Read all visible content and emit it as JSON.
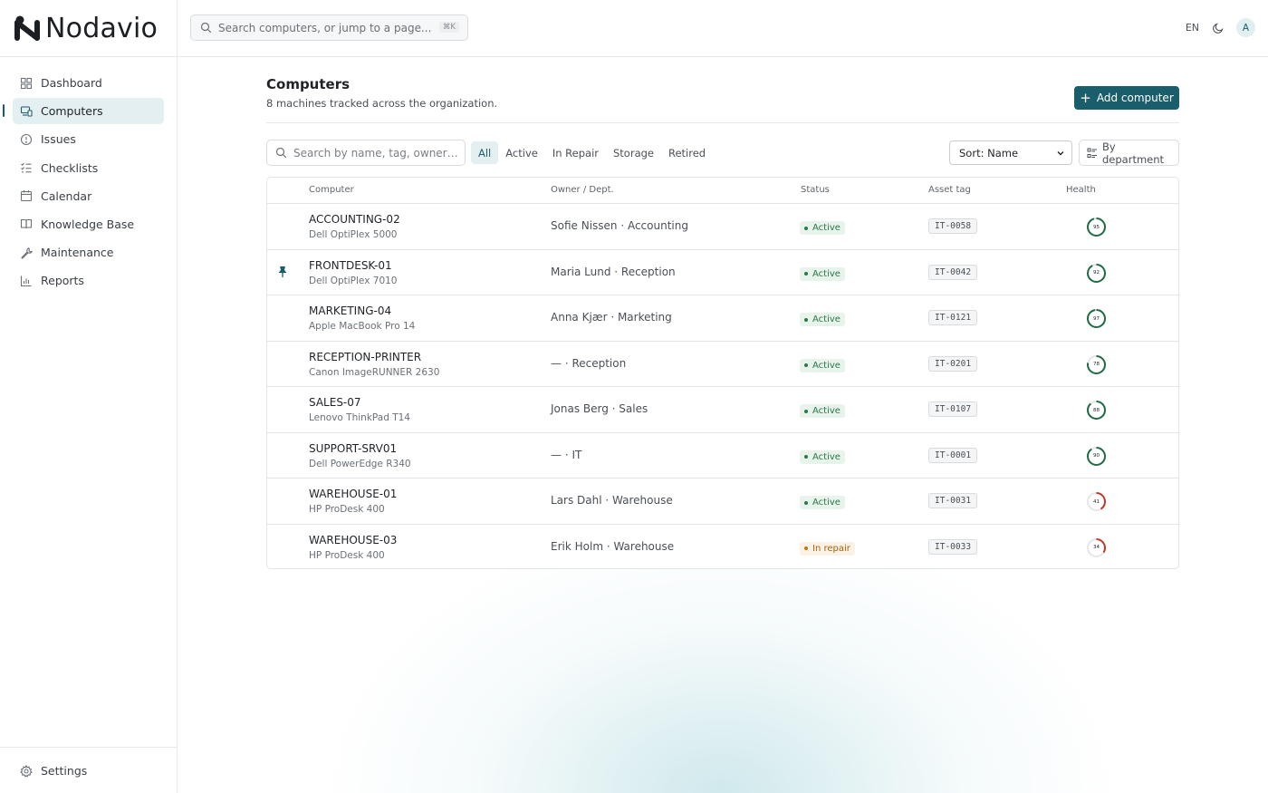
{
  "app": {
    "brand": "Nodavio"
  },
  "topbar": {
    "search_placeholder": "Search computers, or jump to a page...",
    "search_shortcut": "⌘K",
    "language": "EN",
    "avatar_initial": "A"
  },
  "sidebar": {
    "items": [
      {
        "label": "Dashboard",
        "icon": "grid-icon"
      },
      {
        "label": "Computers",
        "icon": "devices-icon",
        "active": true
      },
      {
        "label": "Issues",
        "icon": "alert-circle-icon"
      },
      {
        "label": "Checklists",
        "icon": "checklist-icon"
      },
      {
        "label": "Calendar",
        "icon": "calendar-icon"
      },
      {
        "label": "Knowledge Base",
        "icon": "book-icon"
      },
      {
        "label": "Maintenance",
        "icon": "wrench-icon"
      },
      {
        "label": "Reports",
        "icon": "bar-chart-icon"
      }
    ],
    "settings_label": "Settings"
  },
  "page": {
    "title": "Computers",
    "subtitle": "8 machines tracked across the organization.",
    "add_button": "Add computer"
  },
  "filters": {
    "search_placeholder": "Search by name, tag, owner…",
    "tabs": [
      "All",
      "Active",
      "In Repair",
      "Storage",
      "Retired"
    ],
    "active_tab": "All",
    "sort_label": "Sort: Name",
    "group_label": "By department"
  },
  "table": {
    "columns": [
      "Computer",
      "Owner / Dept.",
      "Status",
      "Asset tag",
      "Health"
    ],
    "rows": [
      {
        "name": "ACCOUNTING-02",
        "model": "Dell OptiPlex 5000",
        "owner": "Sofie Nissen · Accounting",
        "status": "Active",
        "status_kind": "active",
        "tag": "IT-0058",
        "health": 95,
        "pinned": false
      },
      {
        "name": "FRONTDESK-01",
        "model": "Dell OptiPlex 7010",
        "owner": "Maria Lund · Reception",
        "status": "Active",
        "status_kind": "active",
        "tag": "IT-0042",
        "health": 92,
        "pinned": true
      },
      {
        "name": "MARKETING-04",
        "model": "Apple MacBook Pro 14",
        "owner": "Anna Kjær · Marketing",
        "status": "Active",
        "status_kind": "active",
        "tag": "IT-0121",
        "health": 97,
        "pinned": false
      },
      {
        "name": "RECEPTION-PRINTER",
        "model": "Canon ImageRUNNER 2630",
        "owner": "— · Reception",
        "status": "Active",
        "status_kind": "active",
        "tag": "IT-0201",
        "health": 78,
        "pinned": false
      },
      {
        "name": "SALES-07",
        "model": "Lenovo ThinkPad T14",
        "owner": "Jonas Berg · Sales",
        "status": "Active",
        "status_kind": "active",
        "tag": "IT-0107",
        "health": 88,
        "pinned": false
      },
      {
        "name": "SUPPORT-SRV01",
        "model": "Dell PowerEdge R340",
        "owner": "— · IT",
        "status": "Active",
        "status_kind": "active",
        "tag": "IT-0001",
        "health": 90,
        "pinned": false
      },
      {
        "name": "WAREHOUSE-01",
        "model": "HP ProDesk 400",
        "owner": "Lars Dahl · Warehouse",
        "status": "Active",
        "status_kind": "active",
        "tag": "IT-0031",
        "health": 41,
        "pinned": false
      },
      {
        "name": "WAREHOUSE-03",
        "model": "HP ProDesk 400",
        "owner": "Erik Holm · Warehouse",
        "status": "In repair",
        "status_kind": "repair",
        "tag": "IT-0033",
        "health": 34,
        "pinned": false
      }
    ]
  },
  "colors": {
    "accent": "#1b5e6b",
    "health_good": "#1f6b45",
    "health_bad": "#c0392b",
    "status_active": "#2a7a46",
    "status_repair": "#a9620f"
  }
}
